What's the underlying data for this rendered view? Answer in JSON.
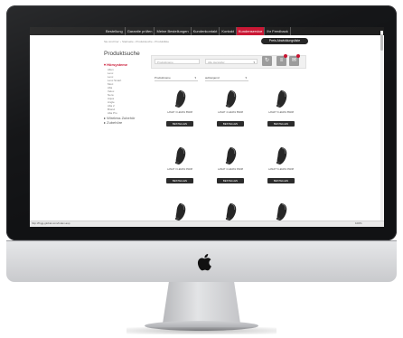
{
  "nav": {
    "items": [
      {
        "label": "Bestellung"
      },
      {
        "label": "Garantie prüfen"
      },
      {
        "label": "Meine Bestellungen"
      },
      {
        "label": "Kundenkontakt"
      },
      {
        "label": "Kontakt"
      },
      {
        "label": "Kundenservice",
        "active": true
      },
      {
        "label": "Ihr Feedback"
      }
    ]
  },
  "breadcrumb": "Sie sind hier: › Startseite › Produktsuche › Produktliste",
  "preview_button": "Preis Abwicklungsliste",
  "sidebar": {
    "title": "Produktsuche",
    "active_category": "Hörsysteme",
    "sub_items": [
      "Allen",
      "Lexx",
      "Lexx",
      "Lexx Smart",
      "Moxi",
      "Alta",
      "Velox",
      "Nera",
      "Aqua",
      "Angle",
      "Alta 2",
      "Brand",
      "Alta Pro"
    ],
    "categories": [
      "Wireless Zubehör",
      "Zubehöre"
    ]
  },
  "filters": {
    "search_placeholder": "Produktname",
    "brand_select": "Alle Hersteller",
    "sort_by": "Produktname",
    "sort_order": "aufsteigend"
  },
  "icons": {
    "refresh": "refresh-icon",
    "compare": "compare-icon",
    "cart": "cart-icon"
  },
  "products": [
    {
      "name": "LAMAT 3 LEMAS BW08",
      "order": "BESTELLEN"
    },
    {
      "name": "LAMAT 4 LEMAS BW08",
      "order": "BESTELLEN"
    },
    {
      "name": "LAMAT 5 LEMAS BW08",
      "order": "BESTELLEN"
    },
    {
      "name": "LAMAT 3 LEMAS DW08",
      "order": "BESTELLEN"
    },
    {
      "name": "LAMAT 4 LEMAS DW08",
      "order": "BESTELLEN"
    },
    {
      "name": "LAMAT 5 LEMAS DW08",
      "order": "BESTELLEN"
    }
  ],
  "status_bar": {
    "url": "http://lhgg-global.com/index.asp",
    "zoom": "100%"
  },
  "colors": {
    "accent": "#c8102e",
    "nav_bg": "#1b1b1b"
  }
}
